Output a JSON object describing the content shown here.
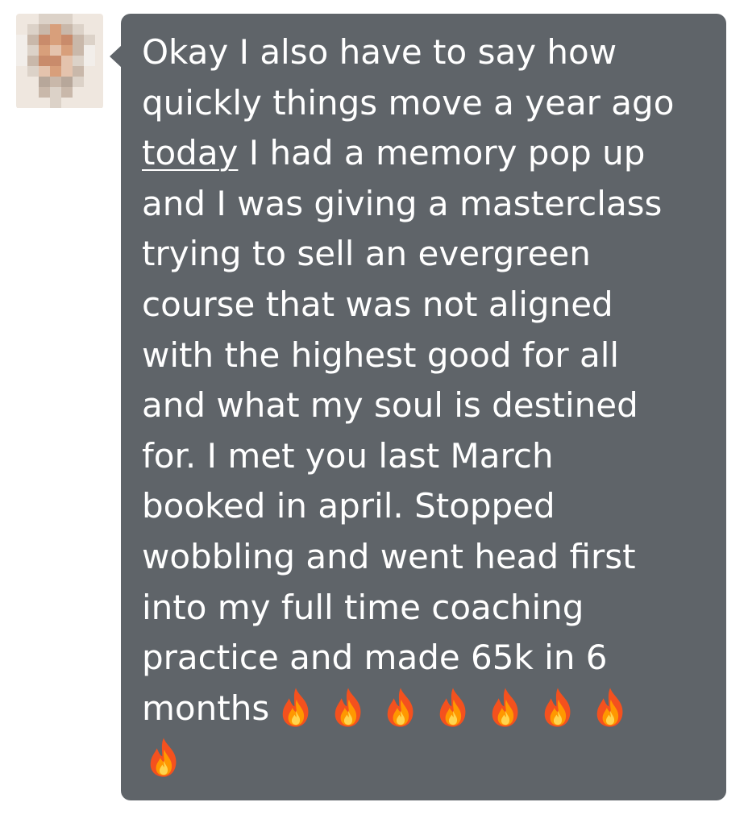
{
  "contact": {
    "avatar_icon": "pixelated-profile-avatar-icon",
    "avatar_palette": [
      "#f2eeea",
      "#dcd2c8",
      "#c9b8aa",
      "#d89f7b",
      "#c98b6b",
      "#e4c3ad",
      "#b7a79a",
      "#efe7df"
    ]
  },
  "message": {
    "bubble_color": "#5f6469",
    "text_color": "#ffffff",
    "lines": [
      "Okay I also have to say how",
      "quickly things move a year ago",
      "I had a memory pop up",
      "and I was giving a masterclass",
      "trying to sell an evergreen",
      "course that was not aligned",
      "with the highest good for all",
      "and what my soul is destined",
      "for. I met you last March",
      "booked in april. Stopped",
      "wobbling and went head first",
      "into my full time coaching",
      "practice and made 65k in 6",
      "months"
    ],
    "linked_word": "today",
    "fire_emoji_icon": "fire-emoji-icon",
    "fire_emoji_count": 8
  }
}
